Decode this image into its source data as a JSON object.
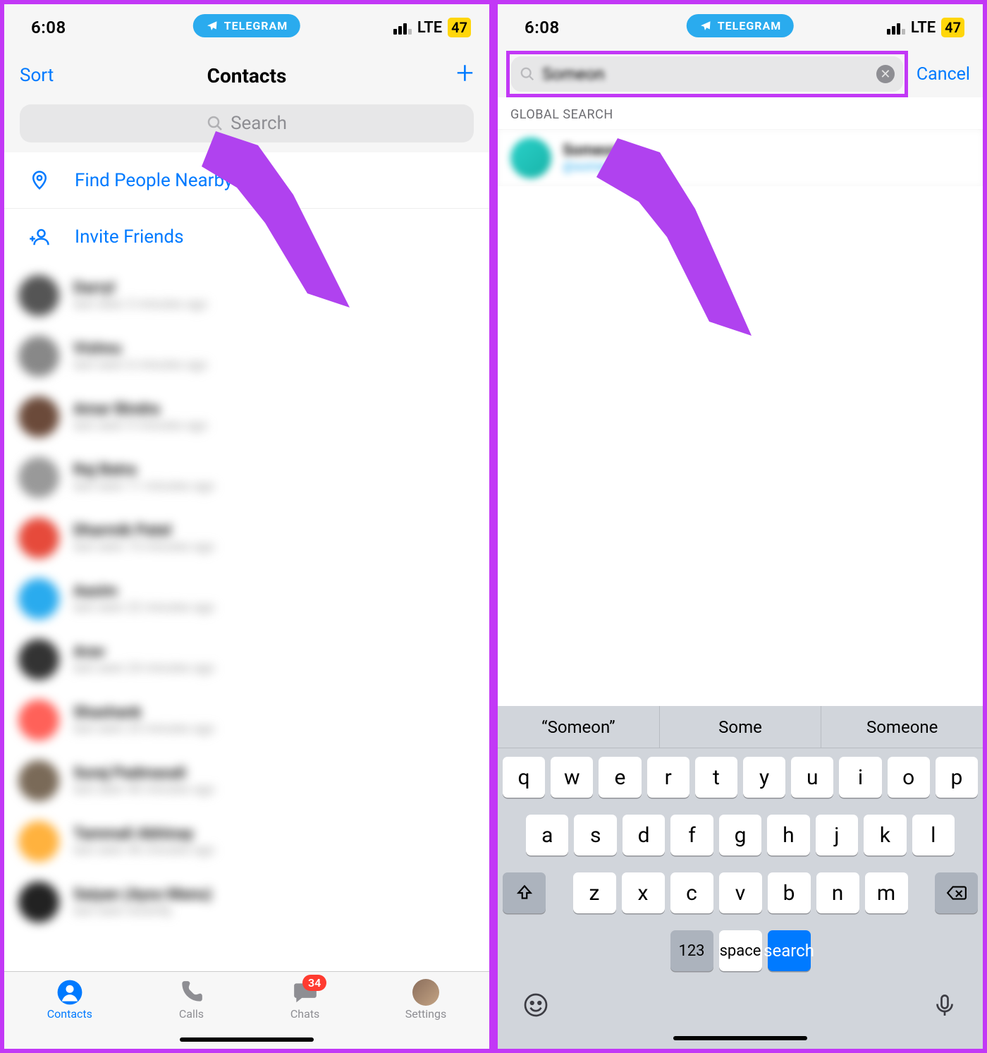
{
  "status": {
    "time": "6:08",
    "carrier_pill": "TELEGRAM",
    "net": "LTE",
    "battery": "47"
  },
  "left": {
    "nav": {
      "sort": "Sort",
      "title": "Contacts"
    },
    "search_placeholder": "Search",
    "actions": {
      "nearby": "Find People Nearby",
      "invite": "Invite Friends"
    },
    "contacts": [
      {
        "name": "Darryl",
        "sub": "last seen 3 minutes ago",
        "color": "#555"
      },
      {
        "name": "Vishnu",
        "sub": "last seen 6 minutes ago",
        "color": "#888"
      },
      {
        "name": "Amar Bindra",
        "sub": "last seen 9 minutes ago",
        "color": "#6b4a3a"
      },
      {
        "name": "Raj Batra",
        "sub": "last seen 11 minutes ago",
        "color": "#999"
      },
      {
        "name": "Dharmik Patel",
        "sub": "last seen 15 minutes ago",
        "color": "#e64a3b"
      },
      {
        "name": "Aasim",
        "sub": "last seen 22 minutes ago",
        "color": "#2AABEE"
      },
      {
        "name": "Arav",
        "sub": "last seen 24 minutes ago",
        "color": "#333"
      },
      {
        "name": "Shashank",
        "sub": "last seen 25 minutes ago",
        "color": "#ff6159"
      },
      {
        "name": "Suraj Padmasali",
        "sub": "last seen 40 minutes ago",
        "color": "#7a6a58"
      },
      {
        "name": "Tammali Abhinay",
        "sub": "last seen 46 minutes ago",
        "color": "#ffb23e"
      },
      {
        "name": "Saiyan (Ayso Manu)",
        "sub": "last seen recently",
        "color": "#222"
      }
    ],
    "tabs": {
      "contacts": "Contacts",
      "calls": "Calls",
      "chats": "Chats",
      "settings": "Settings",
      "badge": "34"
    }
  },
  "right": {
    "search_value": "Someon",
    "cancel": "Cancel",
    "section": "GLOBAL SEARCH",
    "result": {
      "name": "Someone",
      "sub": "@someone"
    },
    "suggestions": [
      "“Someon”",
      "Some",
      "Someone"
    ],
    "rows": [
      [
        "q",
        "w",
        "e",
        "r",
        "t",
        "y",
        "u",
        "i",
        "o",
        "p"
      ],
      [
        "a",
        "s",
        "d",
        "f",
        "g",
        "h",
        "j",
        "k",
        "l"
      ],
      [
        "z",
        "x",
        "c",
        "v",
        "b",
        "n",
        "m"
      ]
    ],
    "num_key": "123",
    "space_key": "space",
    "search_key": "search"
  }
}
